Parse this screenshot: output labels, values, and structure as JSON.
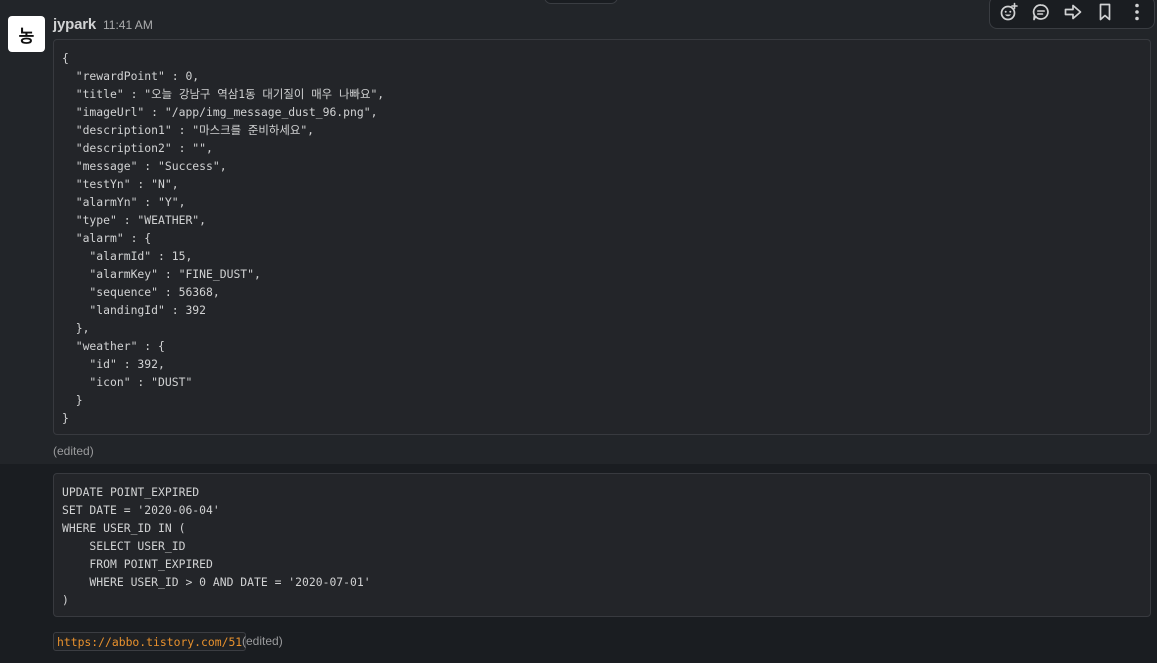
{
  "message": {
    "avatar_initial": "농",
    "author": "jypark",
    "time": "11:41 AM",
    "code_json_lines": [
      "{",
      "  \"rewardPoint\" : 0,",
      "  \"title\" : \"오늘 강남구 역삼1동 대기질이 매우 나빠요\",",
      "  \"imageUrl\" : \"/app/img_message_dust_96.png\",",
      "  \"description1\" : \"마스크를 준비하세요\",",
      "  \"description2\" : \"\",",
      "  \"message\" : \"Success\",",
      "  \"testYn\" : \"N\",",
      "  \"alarmYn\" : \"Y\",",
      "  \"type\" : \"WEATHER\",",
      "  \"alarm\" : {",
      "    \"alarmId\" : 15,",
      "    \"alarmKey\" : \"FINE_DUST\",",
      "    \"sequence\" : 56368,",
      "    \"landingId\" : 392",
      "  },",
      "  \"weather\" : {",
      "    \"id\" : 392,",
      "    \"icon\" : \"DUST\"",
      "  }",
      "}"
    ],
    "edited_label": "(edited)"
  },
  "message2": {
    "code_sql_lines": [
      "UPDATE POINT_EXPIRED",
      "SET DATE = '2020-06-04'",
      "WHERE USER_ID IN (",
      "    SELECT USER_ID",
      "    FROM POINT_EXPIRED",
      "    WHERE USER_ID > 0 AND DATE = '2020-07-01'",
      ")"
    ]
  },
  "message3": {
    "link": "https://abbo.tistory.com/51",
    "edited_label": "(edited)"
  },
  "toolbar": {
    "icons": [
      "add-reaction-icon",
      "reply-in-thread-icon",
      "forward-icon",
      "bookmark-icon",
      "more-actions-icon"
    ]
  }
}
